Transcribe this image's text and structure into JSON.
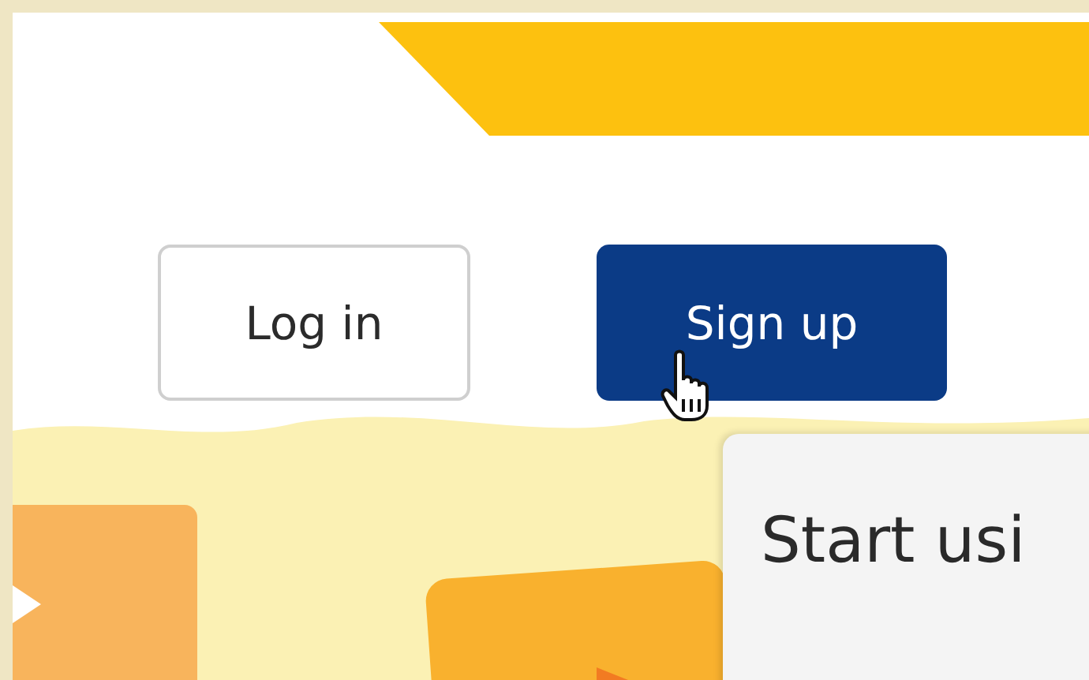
{
  "buttons": [
    {
      "label": "Log in",
      "kind": "secondary"
    },
    {
      "label": "Sign up",
      "kind": "primary"
    }
  ],
  "card": {
    "title": "Start usi"
  }
}
